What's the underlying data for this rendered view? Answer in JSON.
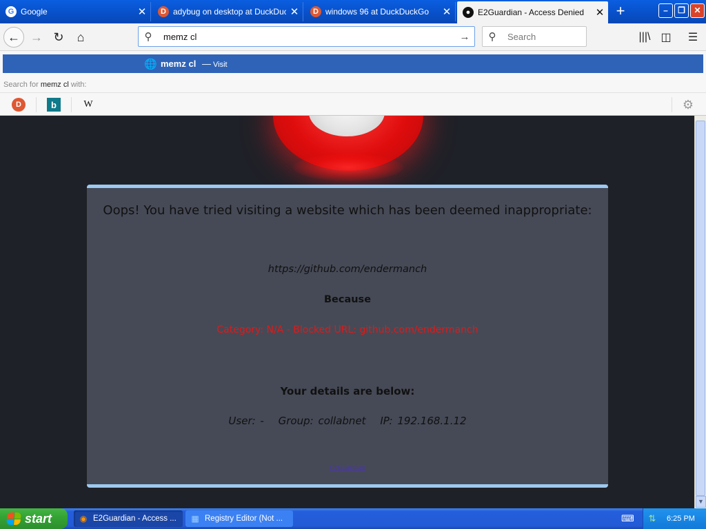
{
  "browser": {
    "tabs": [
      {
        "title": "Google",
        "favicon": "google-icon",
        "active": false
      },
      {
        "title": "adybug on desktop at DuckDuckGo",
        "favicon": "duckduckgo-icon",
        "active": false
      },
      {
        "title": "windows 96 at DuckDuckGo",
        "favicon": "duckduckgo-icon",
        "active": false
      },
      {
        "title": "E2Guardian - Access Denied",
        "favicon": "github-icon",
        "active": true
      }
    ],
    "url_value": "memz cl",
    "search_placeholder": "Search"
  },
  "suggestions": {
    "text": "memz cl",
    "dash": "—",
    "action": "Visit",
    "search_for_prefix": "Search for",
    "search_for_query": "memz cl",
    "search_for_suffix": "with:",
    "engines": [
      {
        "name": "duckduckgo",
        "glyph": "D"
      },
      {
        "name": "bing",
        "glyph": "b"
      },
      {
        "name": "wikipedia",
        "glyph": "W"
      }
    ]
  },
  "page": {
    "headline": "Oops! You have tried visiting a website which has been deemed inappropriate:",
    "blocked_url": "https://github.com/endermanch",
    "because": "Because",
    "reason": "Category: N/A - Blocked URL: github.com/endermanch",
    "details_heading": "Your details are below:",
    "user": "User: -",
    "group": "Group: collabnet",
    "ip": "IP: 192.168.1.12",
    "footer_link": "E2Guardian",
    "colors": {
      "panel_bg": "#464a56",
      "panel_border": "#9ec9ef",
      "reason": "#e01919",
      "page_bg": "#1f2128"
    }
  },
  "taskbar": {
    "start_label": "start",
    "tasks": [
      {
        "label": "E2Guardian - Access ...",
        "icon": "firefox-icon",
        "active": true
      },
      {
        "label": "Registry Editor (Not ...",
        "icon": "regedit-icon",
        "active": false
      }
    ],
    "clock": "6:25 PM"
  }
}
